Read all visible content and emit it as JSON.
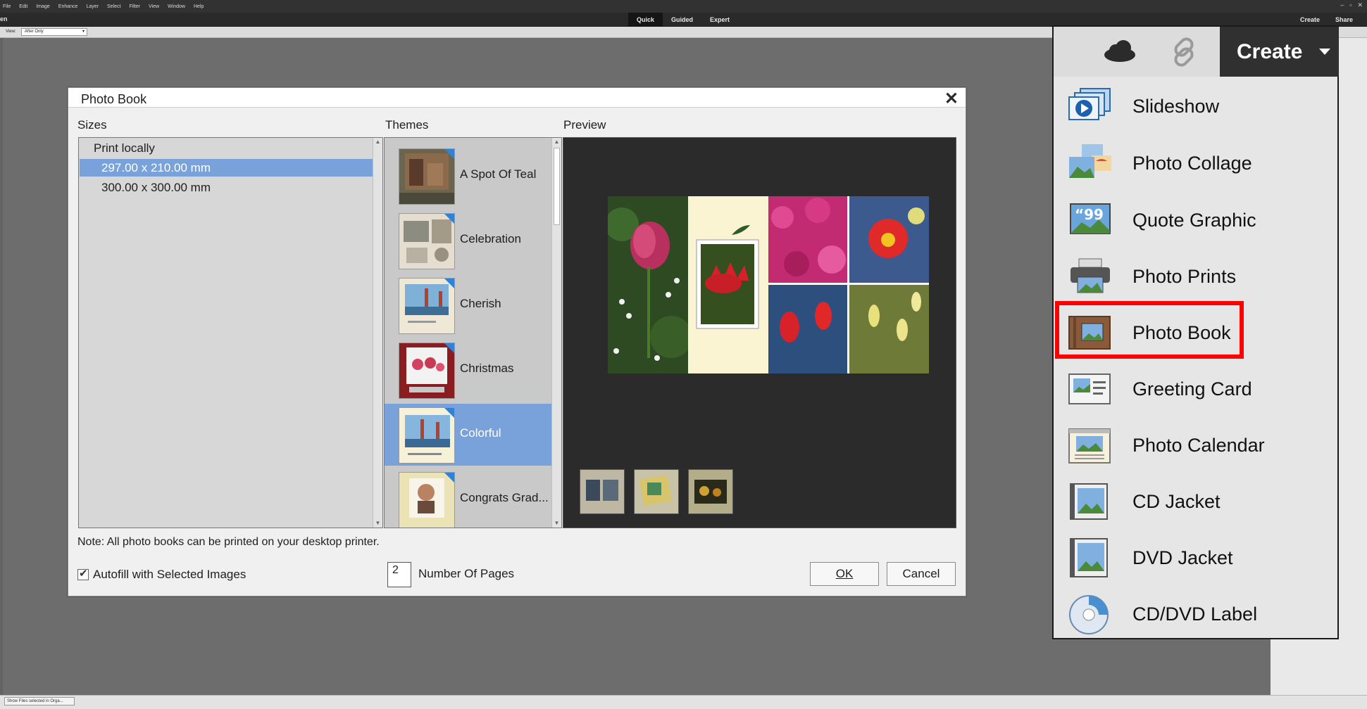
{
  "app": {
    "menu": [
      "File",
      "Edit",
      "Image",
      "Enhance",
      "Layer",
      "Select",
      "Filter",
      "View",
      "Window",
      "Help"
    ],
    "open_label": "en",
    "modes": [
      "Quick",
      "Guided",
      "Expert"
    ],
    "active_mode": "Quick",
    "create_label": "Create",
    "share_label": "Share",
    "view_label": "View:",
    "view_value": "After Only",
    "status_select": "Show Files selected in Orga..."
  },
  "dialog": {
    "title": "Photo Book",
    "sizes_label": "Sizes",
    "themes_label": "Themes",
    "preview_label": "Preview",
    "size_group": "Print locally",
    "sizes": [
      "297.00 x 210.00 mm",
      "300.00 x 300.00 mm"
    ],
    "selected_size": "297.00 x 210.00 mm",
    "themes": [
      "A Spot Of Teal",
      "Celebration",
      "Cherish",
      "Christmas",
      "Colorful",
      "Congrats Grad..."
    ],
    "selected_theme": "Colorful",
    "note": "Note: All photo books can be printed on your desktop printer.",
    "autofill_label": "Autofill with Selected Images",
    "autofill_checked": true,
    "pages_value": "2",
    "pages_label": "Number Of Pages",
    "ok_label": "OK",
    "cancel_label": "Cancel"
  },
  "create_menu": {
    "header_label": "Create",
    "items": [
      {
        "label": "Slideshow",
        "icon": "slideshow-icon"
      },
      {
        "label": "Photo Collage",
        "icon": "photo-collage-icon"
      },
      {
        "label": "Quote Graphic",
        "icon": "quote-graphic-icon"
      },
      {
        "label": "Photo Prints",
        "icon": "printer-icon"
      },
      {
        "label": "Photo Book",
        "icon": "photo-book-icon"
      },
      {
        "label": "Greeting Card",
        "icon": "greeting-card-icon"
      },
      {
        "label": "Photo Calendar",
        "icon": "calendar-icon"
      },
      {
        "label": "CD Jacket",
        "icon": "cd-jacket-icon"
      },
      {
        "label": "DVD Jacket",
        "icon": "dvd-jacket-icon"
      },
      {
        "label": "CD/DVD Label",
        "icon": "disc-label-icon"
      }
    ],
    "highlighted_item": "Photo Book",
    "highlight_color": "#ff0000"
  }
}
